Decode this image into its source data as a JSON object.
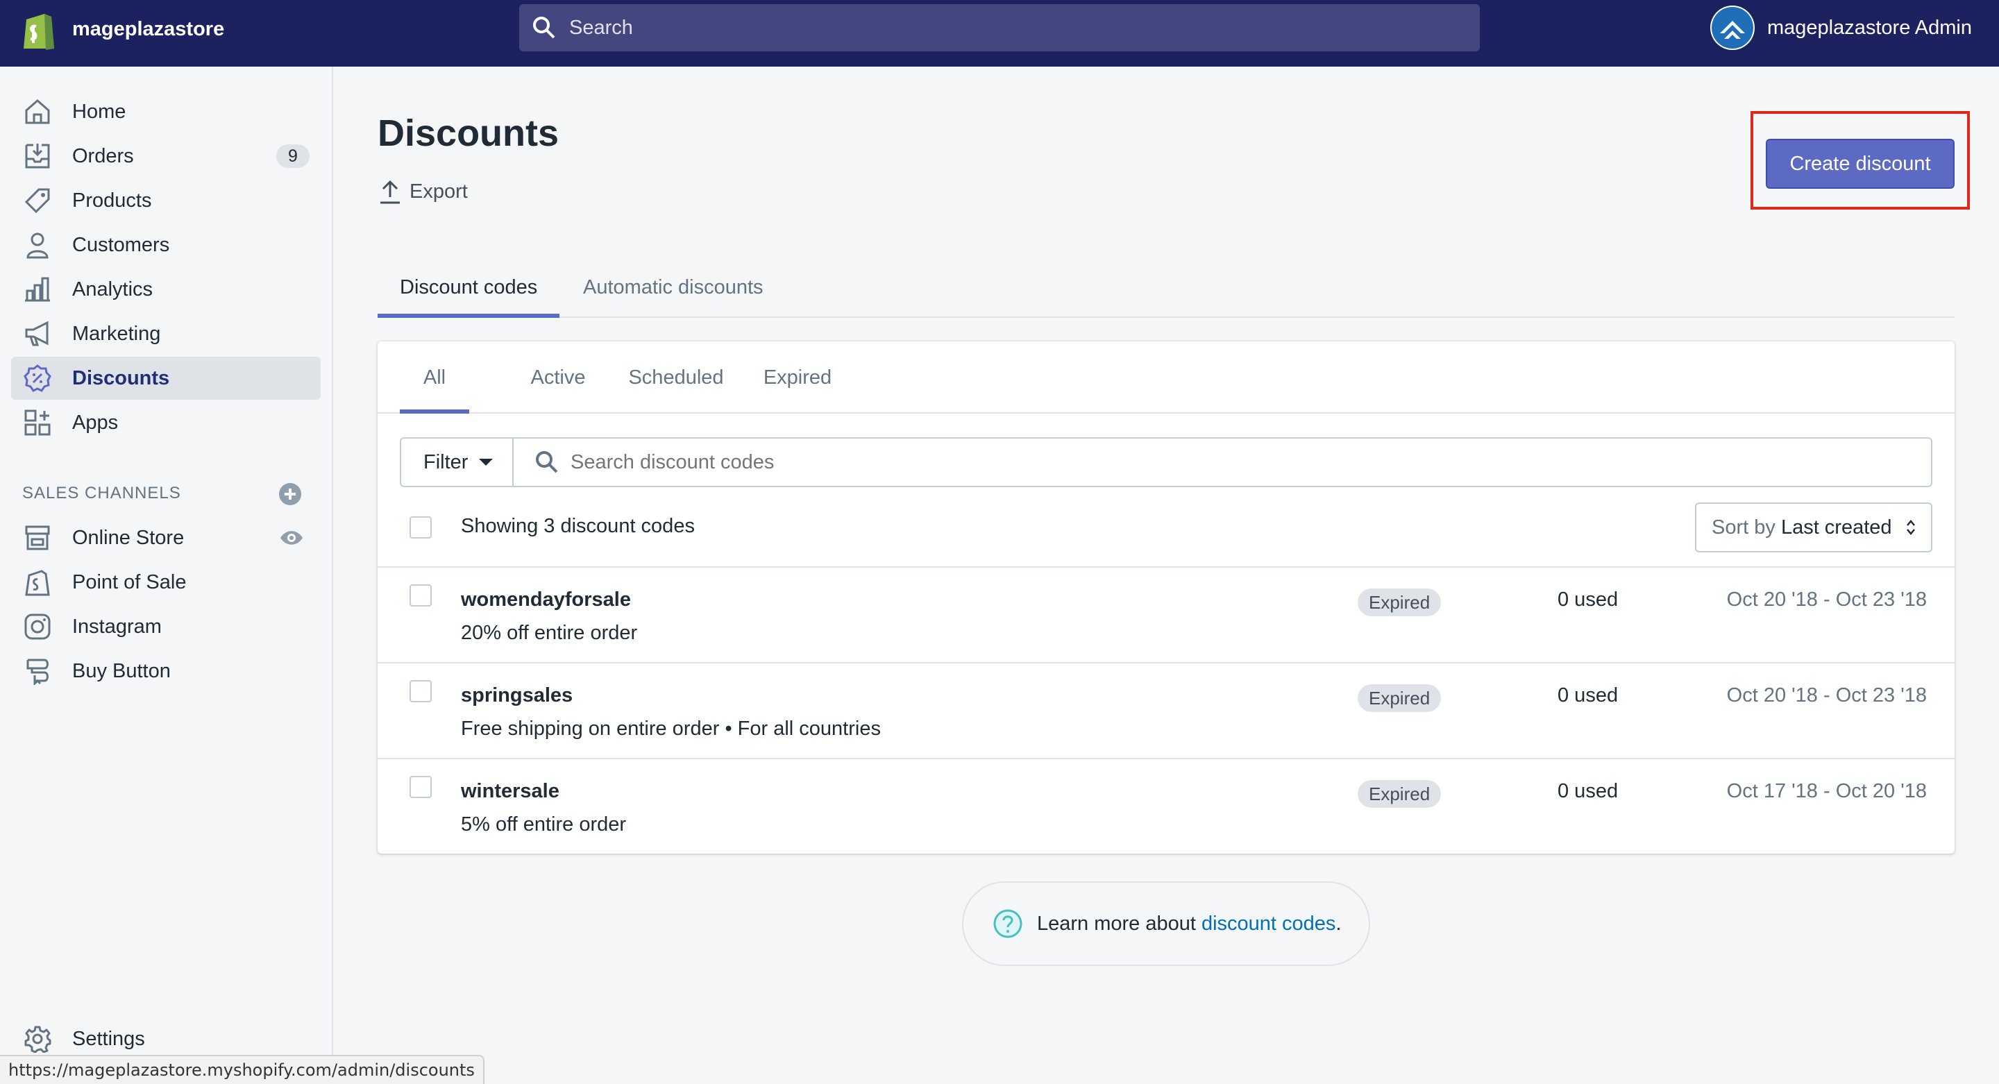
{
  "topbar": {
    "store_name": "mageplazastore",
    "search_placeholder": "Search",
    "admin_name": "mageplazastore Admin"
  },
  "sidebar": {
    "items": [
      {
        "label": "Home",
        "icon": "home-icon"
      },
      {
        "label": "Orders",
        "icon": "orders-icon",
        "badge": "9"
      },
      {
        "label": "Products",
        "icon": "tag-icon"
      },
      {
        "label": "Customers",
        "icon": "person-icon"
      },
      {
        "label": "Analytics",
        "icon": "bar-chart-icon"
      },
      {
        "label": "Marketing",
        "icon": "megaphone-icon"
      },
      {
        "label": "Discounts",
        "icon": "discount-icon",
        "active": true
      },
      {
        "label": "Apps",
        "icon": "apps-icon"
      }
    ],
    "sales_channels_heading": "SALES CHANNELS",
    "channels": [
      {
        "label": "Online Store",
        "icon": "store-icon"
      },
      {
        "label": "Point of Sale",
        "icon": "pos-icon"
      },
      {
        "label": "Instagram",
        "icon": "instagram-icon"
      },
      {
        "label": "Buy Button",
        "icon": "buy-button-icon"
      }
    ],
    "settings_label": "Settings"
  },
  "status_url": "https://mageplazastore.myshopify.com/admin/discounts",
  "main": {
    "title": "Discounts",
    "export_label": "Export",
    "create_button": "Create discount",
    "tabs": [
      "Discount codes",
      "Automatic discounts"
    ],
    "status_tabs": [
      "All",
      "Active",
      "Scheduled",
      "Expired"
    ],
    "filter_label": "Filter",
    "search_placeholder": "Search discount codes",
    "showing_text": "Showing 3 discount codes",
    "sort_prefix": "Sort by",
    "sort_value": "Last created",
    "discounts": [
      {
        "code": "womendayforsale",
        "description": "20% off entire order",
        "status": "Expired",
        "used": "0 used",
        "dates": "Oct 20 '18 - Oct 23 '18"
      },
      {
        "code": "springsales",
        "description": "Free shipping on entire order • For all countries",
        "status": "Expired",
        "used": "0 used",
        "dates": "Oct 20 '18 - Oct 23 '18"
      },
      {
        "code": "wintersale",
        "description": "5% off entire order",
        "status": "Expired",
        "used": "0 used",
        "dates": "Oct 17 '18 - Oct 20 '18"
      }
    ],
    "learn_more": {
      "text": "Learn more about",
      "link": "discount codes",
      "suffix": "."
    }
  },
  "colors": {
    "topbar": "#1c2260",
    "accent": "#5c6ac4",
    "highlight": "#e0271a",
    "link": "#006fbb"
  }
}
